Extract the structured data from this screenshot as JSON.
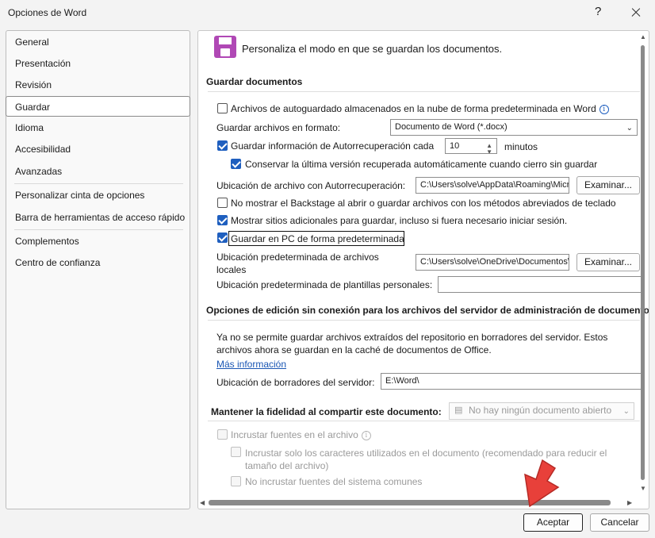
{
  "window": {
    "title": "Opciones de Word",
    "help": "?"
  },
  "nav": {
    "items": [
      {
        "label": "General"
      },
      {
        "label": "Presentación"
      },
      {
        "label": "Revisión"
      },
      {
        "label": "Guardar",
        "selected": true
      },
      {
        "label": "Idioma"
      },
      {
        "label": "Accesibilidad"
      },
      {
        "label": "Avanzadas"
      },
      {
        "label": "Personalizar cinta de opciones"
      },
      {
        "label": "Barra de herramientas de acceso rápido"
      },
      {
        "label": "Complementos"
      },
      {
        "label": "Centro de confianza"
      }
    ]
  },
  "main": {
    "header_text": "Personaliza el modo en que se guardan los documentos.",
    "save_section": {
      "title": "Guardar documentos",
      "cloud_autosave_label": "Archivos de autoguardado almacenados en la nube de forma predeterminada en Word",
      "cloud_autosave_checked": false,
      "format_label": "Guardar archivos en formato:",
      "format_value": "Documento de Word (*.docx)",
      "autorecover_label": "Guardar información de Autorrecuperación cada",
      "autorecover_checked": true,
      "autorecover_minutes": "10",
      "minutes_label": "minutos",
      "keep_last_label": "Conservar la última versión recuperada automáticamente cuando cierro sin guardar",
      "keep_last_checked": true,
      "autorecover_location_label": "Ubicación de archivo con Autorrecuperación:",
      "autorecover_location_value": "C:\\Users\\solve\\AppData\\Roaming\\Microsoft\\Word\\",
      "browse_label": "Examinar...",
      "no_backstage_label": "No mostrar el Backstage al abrir o guardar archivos con los métodos abreviados de teclado",
      "no_backstage_checked": false,
      "show_places_label": "Mostrar sitios adicionales para guardar, incluso si fuera necesario iniciar sesión.",
      "show_places_checked": true,
      "save_pc_label": "Guardar en PC de forma predeterminada",
      "save_pc_checked": true,
      "local_location_label": "Ubicación predeterminada de archivos locales",
      "local_location_value": "C:\\Users\\solve\\OneDrive\\Documentos\\",
      "templates_location_label": "Ubicación predeterminada de plantillas personales:",
      "templates_location_value": ""
    },
    "offline_section": {
      "title": "Opciones de edición sin conexión para los archivos del servidor de administración de documentos",
      "description": "Ya no se permite guardar archivos extraídos del repositorio en borradores del servidor. Estos archivos ahora se guardan en la caché de documentos de Office.",
      "more_info": "Más información",
      "drafts_label": "Ubicación de borradores del servidor:",
      "drafts_value": "E:\\Word\\"
    },
    "fidelity_section": {
      "title": "Mantener la fidelidad al compartir este documento:",
      "document_select": "No hay ningún documento abierto",
      "embed_fonts_label": "Incrustar fuentes en el archivo",
      "embed_used_label": "Incrustar solo los caracteres utilizados en el documento (recomendado para reducir el tamaño del archivo)",
      "no_common_label": "No incrustar fuentes del sistema comunes"
    }
  },
  "footer": {
    "ok_label": "Aceptar",
    "cancel_label": "Cancelar"
  },
  "colors": {
    "accent": "#1f5fbf",
    "save_icon": "#b048b5",
    "annotation_arrow": "#e8403a"
  },
  "icons": [
    "close-icon",
    "help-icon",
    "save-icon",
    "info-icon",
    "dropdown-chevron-icon",
    "red-arrow-annotation"
  ]
}
